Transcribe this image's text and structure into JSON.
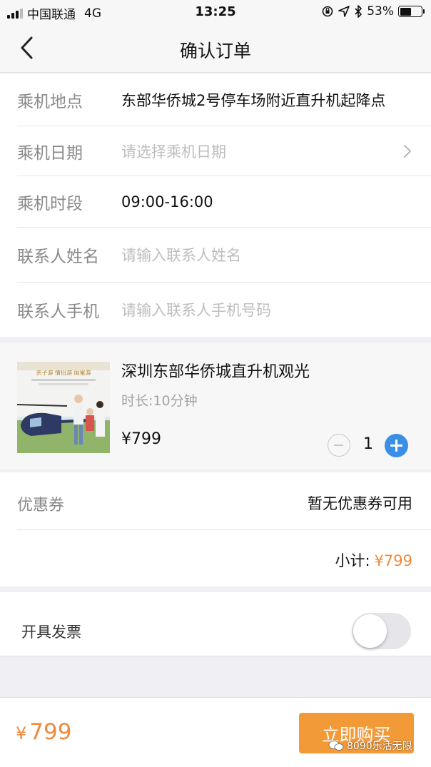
{
  "status_bar": {
    "carrier": "中国联通",
    "network": "4G",
    "time": "13:25",
    "battery": "53%",
    "battery_level": 0.53
  },
  "nav": {
    "title": "确认订单",
    "back_icon": "chevron-left-icon"
  },
  "form": {
    "location_label": "乘机地点",
    "location_value": "东部华侨城2号停车场附近直升机起降点",
    "date_label": "乘机日期",
    "date_placeholder": "请选择乘机日期",
    "time_label": "乘机时段",
    "time_value": "09:00-16:00",
    "name_label": "联系人姓名",
    "name_placeholder": "请输入联系人姓名",
    "phone_label": "联系人手机",
    "phone_placeholder": "请输入联系人手机号码"
  },
  "product": {
    "name": "深圳东部华侨城直升机观光",
    "duration": "时长:10分钟",
    "price": "¥799",
    "quantity": "1",
    "thumb_tags": "亲子游  情侣游  闺蜜游"
  },
  "coupon": {
    "label": "优惠券",
    "value": "暂无优惠券可用"
  },
  "subtotal": {
    "label": "小计:",
    "amount": "¥799"
  },
  "invoice": {
    "label": "开具发票",
    "enabled": false
  },
  "footer": {
    "currency": "¥",
    "total": "799",
    "buy_label": "立即购买",
    "watermark": "8090乐活无限"
  },
  "colors": {
    "accent_orange": "#f29a38",
    "price_orange": "#f08a3c",
    "plus_blue": "#3a8ee6"
  }
}
